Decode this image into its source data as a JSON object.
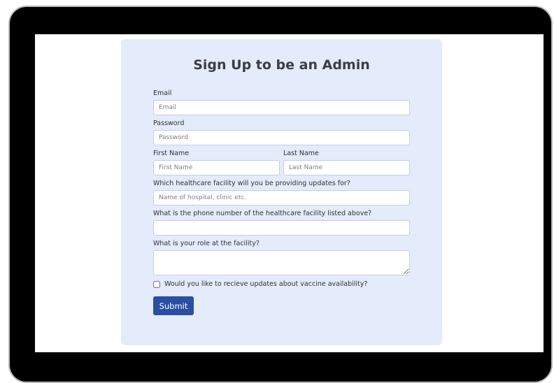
{
  "form": {
    "title": "Sign Up to be an Admin",
    "email": {
      "label": "Email",
      "placeholder": "Email",
      "value": ""
    },
    "password": {
      "label": "Password",
      "placeholder": "Password",
      "value": ""
    },
    "first_name": {
      "label": "First Name",
      "placeholder": "First Name",
      "value": ""
    },
    "last_name": {
      "label": "Last Name",
      "placeholder": "Last Name",
      "value": ""
    },
    "facility": {
      "label": "Which healthcare facility will you be providing updates for?",
      "placeholder": "Name of hospital, clinic etc.",
      "value": ""
    },
    "phone": {
      "label": "What is the phone number of the healthcare facility listed above?",
      "placeholder": "",
      "value": ""
    },
    "role": {
      "label": "What is your role at the facility?",
      "value": ""
    },
    "updates_opt_in": {
      "label": "Would you like to recieve updates about vaccine availability?",
      "checked": false
    },
    "submit_label": "Submit"
  },
  "colors": {
    "card_background": "#e4ebfa",
    "submit_button": "#2a4fa2",
    "device_frame": "#000000"
  }
}
